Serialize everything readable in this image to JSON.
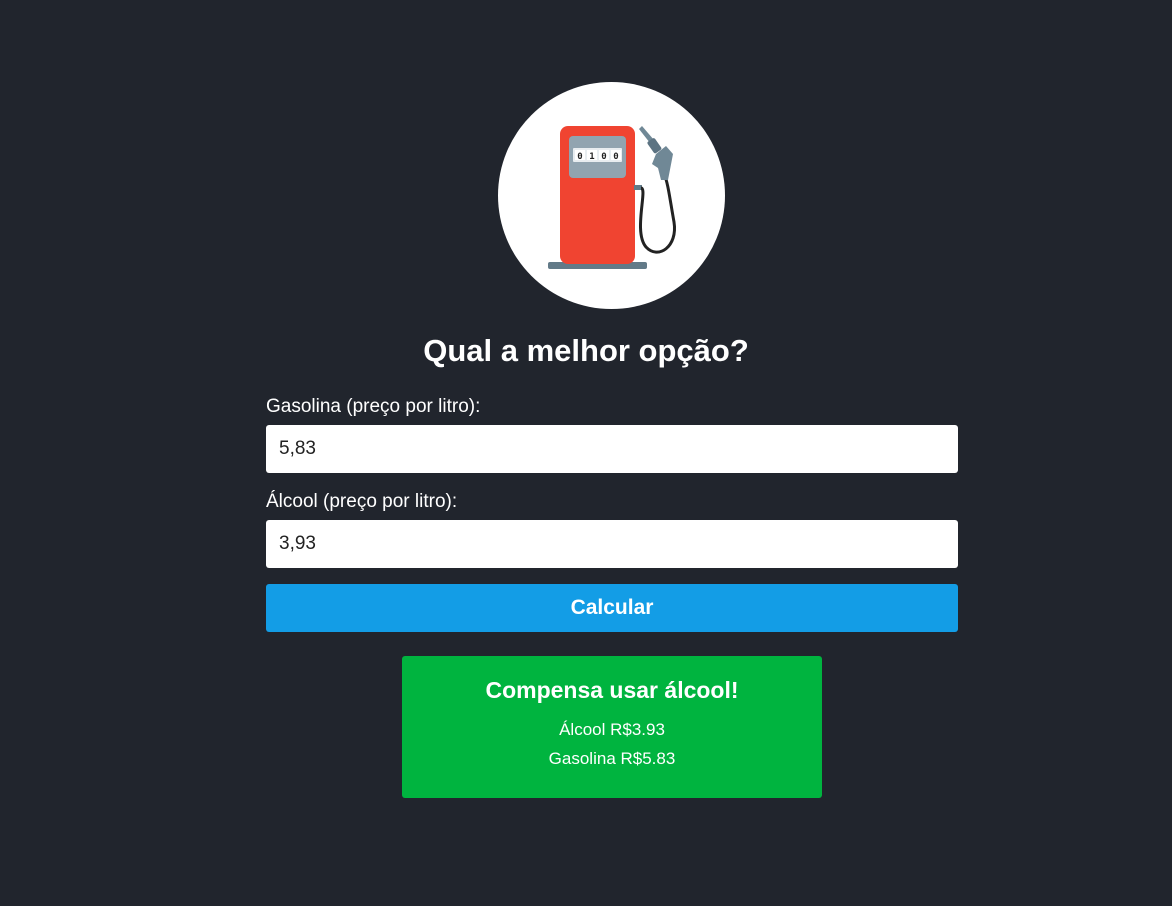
{
  "logo": {
    "icon": "fuel-pump-icon",
    "counter_digits": [
      "0",
      "1",
      "0",
      "0"
    ]
  },
  "heading": "Qual a melhor opção?",
  "form": {
    "gasolina_label": "Gasolina (preço por litro):",
    "gasolina_value": "5,83",
    "alcool_label": "Álcool (preço por litro):",
    "alcool_value": "3,93",
    "submit_label": "Calcular"
  },
  "result": {
    "title": "Compensa usar álcool!",
    "alcool_line": "Álcool R$3.93",
    "gasolina_line": "Gasolina R$5.83"
  },
  "colors": {
    "background": "#21252d",
    "button": "#139de6",
    "result": "#00b43f",
    "pump_body": "#f04431"
  }
}
